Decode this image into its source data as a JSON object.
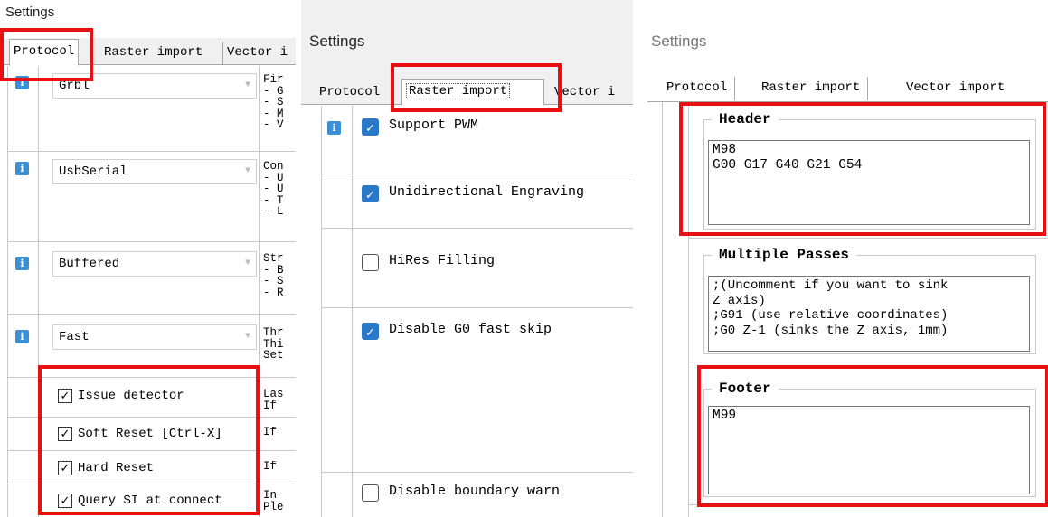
{
  "panel1": {
    "title": "Settings",
    "tabs": [
      "Protocol",
      "Raster import",
      "Vector i"
    ],
    "protocol_rows": [
      {
        "value": "Grbl",
        "desc": "Fir\n- G\n- S\n- M\n- V"
      },
      {
        "value": "UsbSerial",
        "desc": "Con\n- U\n- U\n- T\n- L"
      },
      {
        "value": "Buffered",
        "desc": "Str\n- B\n- S\n- R"
      },
      {
        "value": "Fast",
        "desc": "Thr\nThi\nSet"
      }
    ],
    "check_rows": [
      {
        "label": "Issue detector",
        "desc": "Las\nIf"
      },
      {
        "label": "Soft Reset [Ctrl-X]",
        "desc": "If"
      },
      {
        "label": "Hard Reset",
        "desc": "If"
      },
      {
        "label": "Query $I at connect",
        "desc": "In\nPle"
      }
    ],
    "info_glyph": "i",
    "check_glyph": "✓",
    "dropdown_glyph": "▼"
  },
  "panel2": {
    "title": "Settings",
    "tabs": [
      "Protocol",
      "Raster import",
      "Vector i"
    ],
    "options": [
      {
        "label": "Support PWM",
        "checked": true
      },
      {
        "label": "Unidirectional Engraving",
        "checked": true
      },
      {
        "label": "HiRes Filling",
        "checked": false
      },
      {
        "label": "Disable G0 fast skip",
        "checked": true
      },
      {
        "label": "Disable boundary warn",
        "checked": false
      }
    ]
  },
  "panel3": {
    "title": "Settings",
    "tabs": [
      "Protocol",
      "Raster import",
      "Vector import"
    ],
    "header": {
      "title": "Header",
      "text": "M98\nG00 G17 G40 G21 G54"
    },
    "passes": {
      "title": "Multiple Passes",
      "text": ";(Uncomment if you want to sink\nZ axis)\n;G91 (use relative coordinates)\n;G0 Z-1 (sinks the Z axis, 1mm)"
    },
    "footer": {
      "title": "Footer",
      "text": "M99"
    }
  },
  "colors": {
    "highlight": "#e81010",
    "checkbox_blue": "#2a78c8",
    "info_icon": "#3b8fd4"
  }
}
